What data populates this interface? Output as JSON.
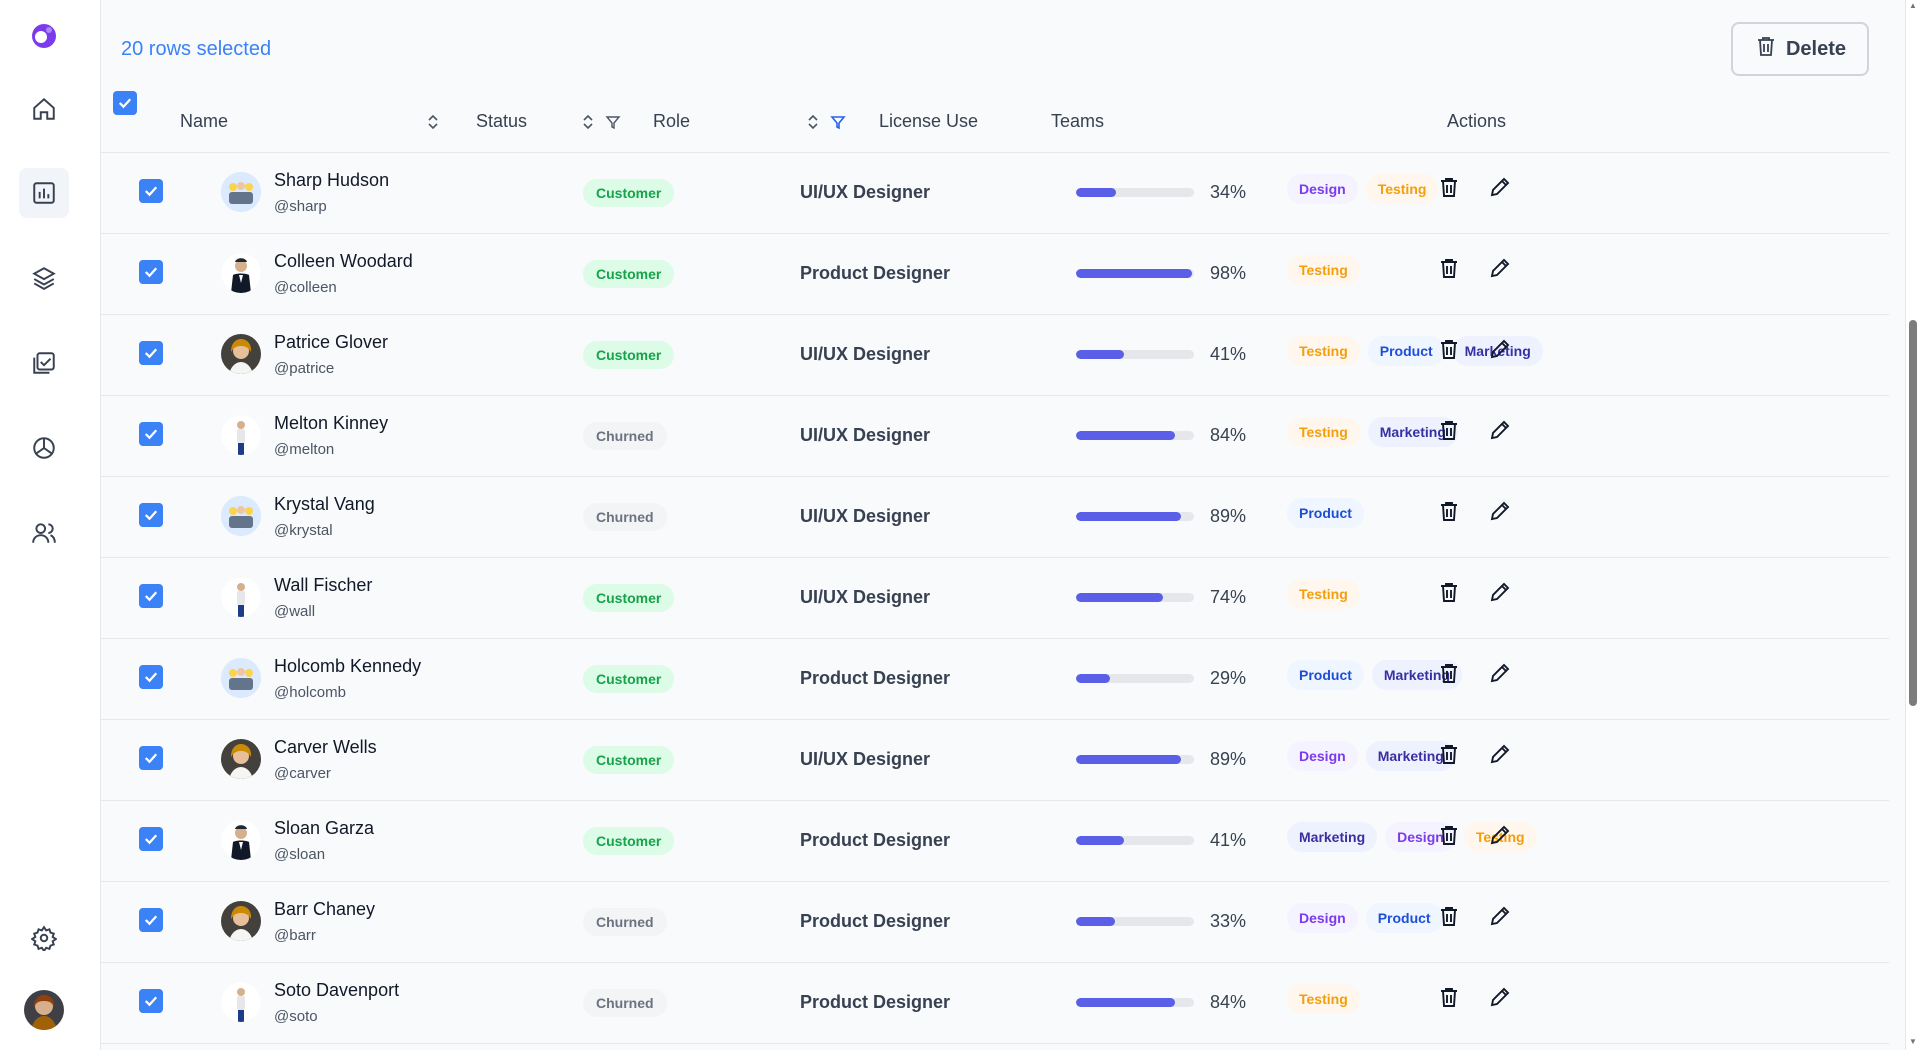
{
  "header": {
    "selected_text": "20 rows selected",
    "delete_label": "Delete"
  },
  "columns": {
    "name": "Name",
    "status": "Status",
    "role": "Role",
    "license": "License Use",
    "teams": "Teams",
    "actions": "Actions"
  },
  "rows": [
    {
      "name": "Sharp Hudson",
      "handle": "@sharp",
      "status": "Customer",
      "role": "UI/UX Designer",
      "license_pct": 34,
      "license_text": "34%",
      "teams": [
        "Design",
        "Testing"
      ]
    },
    {
      "name": "Colleen Woodard",
      "handle": "@colleen",
      "status": "Customer",
      "role": "Product Designer",
      "license_pct": 98,
      "license_text": "98%",
      "teams": [
        "Testing"
      ]
    },
    {
      "name": "Patrice Glover",
      "handle": "@patrice",
      "status": "Customer",
      "role": "UI/UX Designer",
      "license_pct": 41,
      "license_text": "41%",
      "teams": [
        "Testing",
        "Product",
        "Marketing"
      ]
    },
    {
      "name": "Melton Kinney",
      "handle": "@melton",
      "status": "Churned",
      "role": "UI/UX Designer",
      "license_pct": 84,
      "license_text": "84%",
      "teams": [
        "Testing",
        "Marketing"
      ]
    },
    {
      "name": "Krystal Vang",
      "handle": "@krystal",
      "status": "Churned",
      "role": "UI/UX Designer",
      "license_pct": 89,
      "license_text": "89%",
      "teams": [
        "Product"
      ]
    },
    {
      "name": "Wall Fischer",
      "handle": "@wall",
      "status": "Customer",
      "role": "UI/UX Designer",
      "license_pct": 74,
      "license_text": "74%",
      "teams": [
        "Testing"
      ]
    },
    {
      "name": "Holcomb Kennedy",
      "handle": "@holcomb",
      "status": "Customer",
      "role": "Product Designer",
      "license_pct": 29,
      "license_text": "29%",
      "teams": [
        "Product",
        "Marketing"
      ]
    },
    {
      "name": "Carver Wells",
      "handle": "@carver",
      "status": "Customer",
      "role": "UI/UX Designer",
      "license_pct": 89,
      "license_text": "89%",
      "teams": [
        "Design",
        "Marketing"
      ]
    },
    {
      "name": "Sloan Garza",
      "handle": "@sloan",
      "status": "Customer",
      "role": "Product Designer",
      "license_pct": 41,
      "license_text": "41%",
      "teams": [
        "Marketing",
        "Design",
        "Testing"
      ]
    },
    {
      "name": "Barr Chaney",
      "handle": "@barr",
      "status": "Churned",
      "role": "Product Designer",
      "license_pct": 33,
      "license_text": "33%",
      "teams": [
        "Design",
        "Product"
      ]
    },
    {
      "name": "Soto Davenport",
      "handle": "@soto",
      "status": "Churned",
      "role": "Product Designer",
      "license_pct": 84,
      "license_text": "84%",
      "teams": [
        "Testing"
      ]
    }
  ],
  "colors": {
    "accent": "#3b82f6",
    "license_bar": "#5b5fe8",
    "customer": "#16a34a",
    "churned": "#6b7280"
  },
  "icons": {
    "sidebar": [
      "home-icon",
      "analytics-icon",
      "layers-icon",
      "tasks-icon",
      "pie-chart-icon",
      "users-icon",
      "gear-icon"
    ]
  }
}
